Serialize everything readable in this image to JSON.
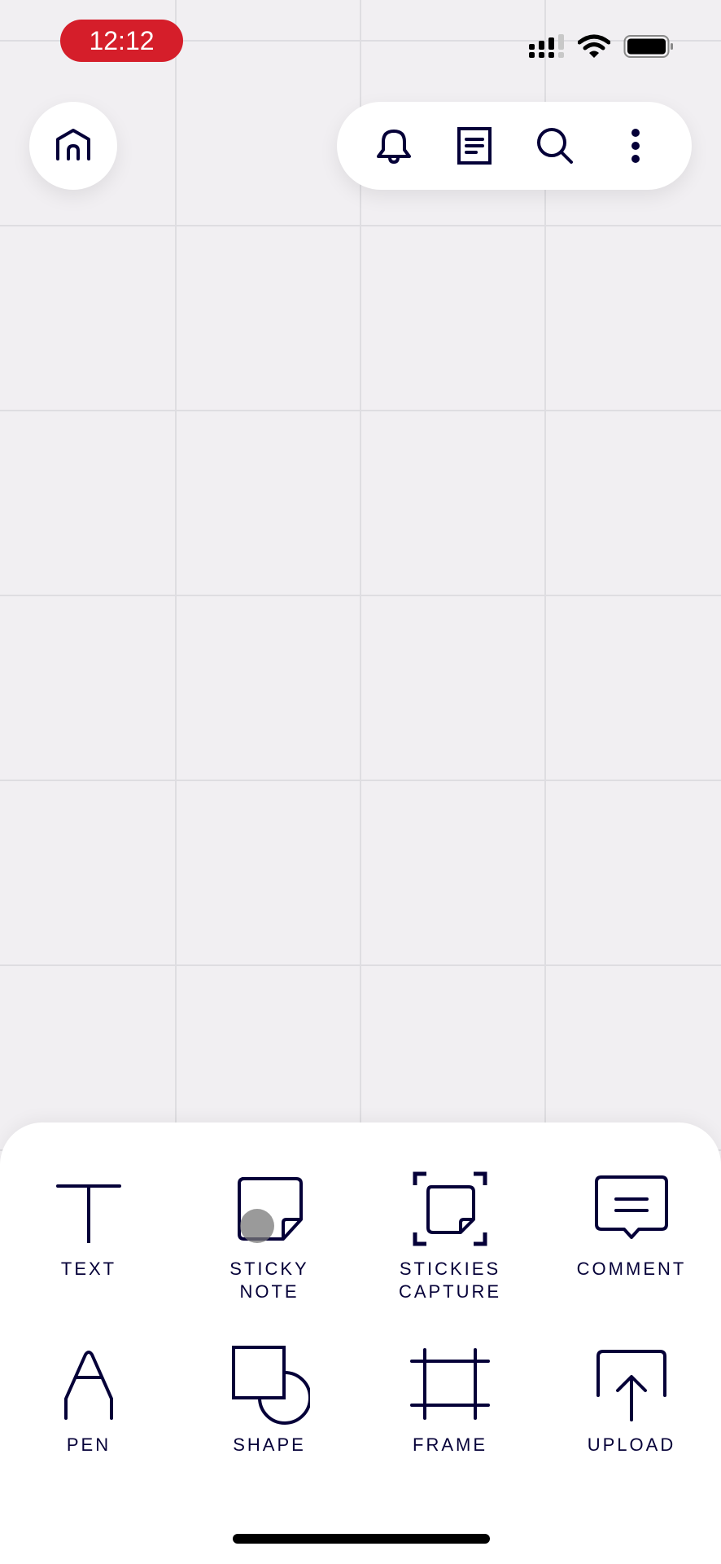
{
  "status_bar": {
    "time": "12:12",
    "icons": [
      "cellular-signal-icon",
      "wifi-icon",
      "battery-icon"
    ],
    "time_badge_color": "#d51e2a"
  },
  "top_bar": {
    "home_icon": "home-icon",
    "actions": [
      {
        "name": "notifications",
        "icon": "bell-icon"
      },
      {
        "name": "board-info",
        "icon": "document-icon"
      },
      {
        "name": "search",
        "icon": "search-icon"
      },
      {
        "name": "more",
        "icon": "more-vertical-icon"
      }
    ]
  },
  "toolbar_sheet": {
    "tools": [
      {
        "label": "TEXT",
        "icon": "text-icon"
      },
      {
        "label": "STICKY\nNOTE",
        "icon": "sticky-note-icon"
      },
      {
        "label": "STICKIES\nCAPTURE",
        "icon": "stickies-capture-icon"
      },
      {
        "label": "COMMENT",
        "icon": "comment-icon"
      },
      {
        "label": "PEN",
        "icon": "pen-icon"
      },
      {
        "label": "SHAPE",
        "icon": "shape-icon"
      },
      {
        "label": "FRAME",
        "icon": "frame-icon"
      },
      {
        "label": "UPLOAD",
        "icon": "upload-icon"
      }
    ]
  },
  "colors": {
    "canvas_bg": "#f1eff2",
    "grid_line": "#dedde1",
    "ink": "#050038"
  }
}
